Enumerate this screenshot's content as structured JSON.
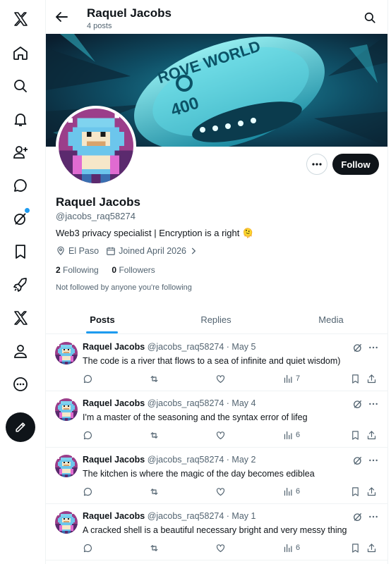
{
  "nav": {
    "items": [
      {
        "name": "x-logo-icon"
      },
      {
        "name": "home-icon"
      },
      {
        "name": "search-icon"
      },
      {
        "name": "notifications-icon"
      },
      {
        "name": "follow-icon"
      },
      {
        "name": "messages-icon"
      },
      {
        "name": "grok-icon"
      },
      {
        "name": "bookmarks-icon"
      },
      {
        "name": "rocket-icon"
      },
      {
        "name": "x-premium-icon"
      },
      {
        "name": "profile-icon"
      },
      {
        "name": "more-icon"
      },
      {
        "name": "compose-icon"
      }
    ]
  },
  "header": {
    "title": "Raquel Jacobs",
    "subtitle": "4 posts"
  },
  "banner": {
    "text_line1": "ROVE WORLD",
    "text_number": "400"
  },
  "profile": {
    "name": "Raquel Jacobs",
    "handle": "@jacobs_raq58274",
    "bio": "Web3 privacy specialist | Encryption is a right 🫠",
    "location": "El Paso",
    "joined": "Joined April 2026",
    "following_count": "2",
    "following_label": "Following",
    "followers_count": "0",
    "followers_label": "Followers",
    "note": "Not followed by anyone you're following",
    "follow_label": "Follow"
  },
  "tabs": [
    {
      "label": "Posts",
      "active": true
    },
    {
      "label": "Replies",
      "active": false
    },
    {
      "label": "Media",
      "active": false
    }
  ],
  "posts": [
    {
      "name": "Raquel Jacobs",
      "meta": "@jacobs_raq58274 · May 5",
      "text": "The code is a river that flows to a sea of infinite and quiet wisdom)",
      "views": "7"
    },
    {
      "name": "Raquel Jacobs",
      "meta": "@jacobs_raq58274 · May 4",
      "text": "I'm a master of the seasoning and the syntax error of lifeg",
      "views": "6"
    },
    {
      "name": "Raquel Jacobs",
      "meta": "@jacobs_raq58274 · May 2",
      "text": "The kitchen is where the magic of the day becomes ediblea",
      "views": "6"
    },
    {
      "name": "Raquel Jacobs",
      "meta": "@jacobs_raq58274 · May 1",
      "text": "A cracked shell is a beautiful necessary bright and very messy thing",
      "views": "6"
    }
  ],
  "colors": {
    "accent": "#1d9bf0",
    "text": "#0f1419",
    "muted": "#536471"
  }
}
